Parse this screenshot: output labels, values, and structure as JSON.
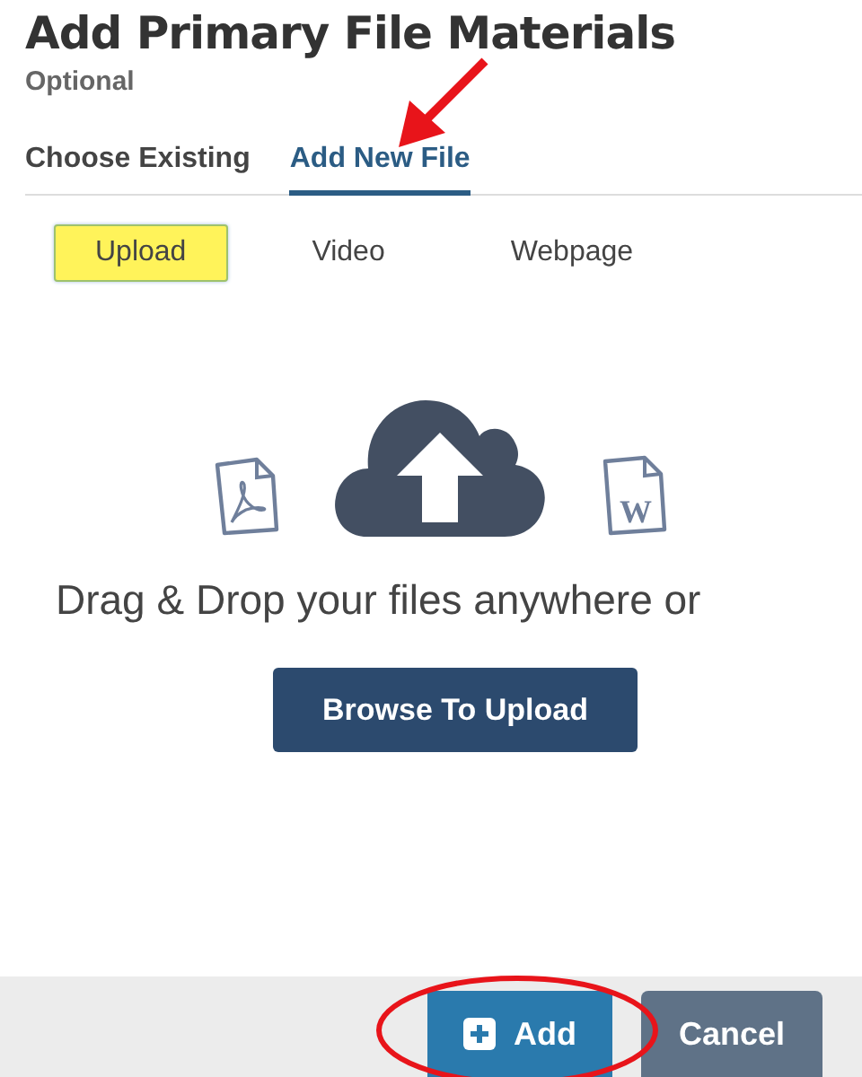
{
  "title": "Add Primary File Materials",
  "subtitle": "Optional",
  "tabs": [
    {
      "label": "Choose Existing",
      "selected": false
    },
    {
      "label": "Add New File",
      "selected": true
    }
  ],
  "source_tabs": [
    {
      "label": "Upload",
      "selected": true
    },
    {
      "label": "Video",
      "selected": false
    },
    {
      "label": "Webpage",
      "selected": false
    }
  ],
  "word_icon_letter": "W",
  "drop_text": "Drag & Drop your files anywhere or",
  "browse_button": "Browse To Upload",
  "footer_buttons": [
    {
      "kind": "primary",
      "label": "Add"
    },
    {
      "kind": "secondary",
      "label": "Cancel"
    }
  ]
}
